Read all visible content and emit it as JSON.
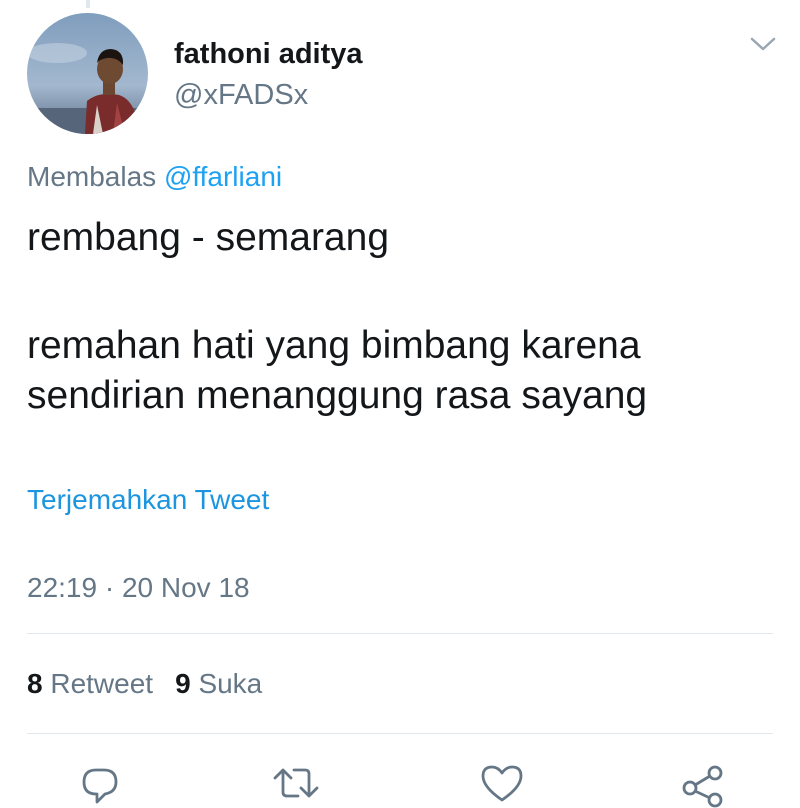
{
  "tweet": {
    "author": {
      "display_name": "fathoni aditya",
      "handle": "@xFADSx"
    },
    "reply_prefix": "Membalas ",
    "reply_to": "@ffarliani",
    "text_lines": [
      "rembang - semarang",
      "remahan hati yang bimbang karena",
      "sendirian menanggung rasa sayang"
    ],
    "translate_label": "Terjemahkan Tweet",
    "timestamp": "22:19 · 20 Nov 18",
    "stats": {
      "retweet_count": "8",
      "retweet_label": "Retweet",
      "like_count": "9",
      "like_label": "Suka"
    }
  },
  "icons": {
    "caret": "chevron-down-icon",
    "reply": "reply-icon",
    "retweet": "retweet-icon",
    "like": "heart-icon",
    "share": "share-icon"
  },
  "colors": {
    "link": "#1da1f2",
    "secondary_text": "#657786",
    "primary_text": "#14171a",
    "divider": "#e1e8ed"
  }
}
